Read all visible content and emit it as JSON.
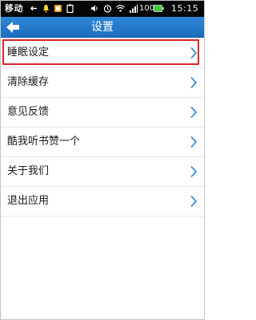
{
  "status_bar": {
    "carrier": "移动",
    "battery": "100%",
    "time": "15:15"
  },
  "header": {
    "title": "设置",
    "back_icon": "arrow-left-icon"
  },
  "menu": {
    "chevron_icon": "chevron-right-icon",
    "items": [
      {
        "label": "睡眠设定"
      },
      {
        "label": "清除缓存"
      },
      {
        "label": "意见反馈"
      },
      {
        "label": "酷我听书赞一个"
      },
      {
        "label": "关于我们"
      },
      {
        "label": "退出应用"
      }
    ]
  },
  "colors": {
    "title_bar": "#1d6fc0",
    "highlight": "#d8262a",
    "chevron": "#3a8fe0"
  }
}
